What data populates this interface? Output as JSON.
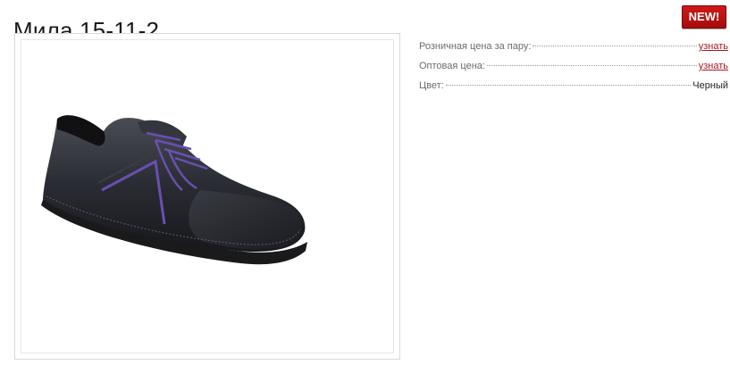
{
  "product": {
    "title": "Мила 15-11-2",
    "badge": "NEW!",
    "image_alt": "black-leather-shoe-with-purple-laces"
  },
  "specs": [
    {
      "label": "Розничная цена за пару:",
      "value": "узнать",
      "is_link": true
    },
    {
      "label": "Оптовая цена:",
      "value": "узнать",
      "is_link": true
    },
    {
      "label": "Цвет:",
      "value": "Черный",
      "is_link": false
    }
  ],
  "colors": {
    "badge_bg": "#c21212",
    "link": "#a8191e",
    "shoe": "#2b2d33",
    "laces": "#6a4fb0"
  }
}
